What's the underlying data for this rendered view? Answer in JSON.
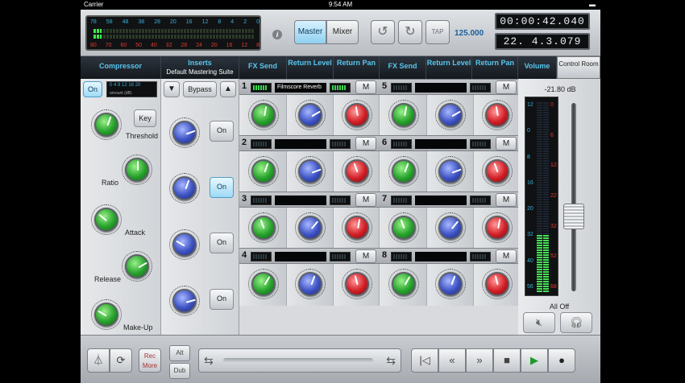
{
  "status": {
    "carrier": "Carrier",
    "time": "9:54 AM"
  },
  "meter": {
    "top_scale": [
      "78",
      "58",
      "48",
      "38",
      "28",
      "20",
      "16",
      "12",
      "8",
      "4",
      "2",
      "0"
    ],
    "bottom_scale": [
      "80",
      "70",
      "60",
      "50",
      "40",
      "32",
      "28",
      "24",
      "20",
      "16",
      "12",
      "8"
    ],
    "level_a": 0.05,
    "level_b": 0.05
  },
  "info_label": "i",
  "tabs": {
    "master": "Master",
    "mixer": "Mixer"
  },
  "tap_label": "TAP",
  "bpm": "125.000",
  "timecode": "00:00:42.040",
  "bars_beats": "22. 4.3.079",
  "compressor": {
    "title": "Compressor",
    "on_label": "On",
    "amount_scale": "0 4 8 12 16 20",
    "amount_label": "amount (dB)",
    "key_label": "Key",
    "params": [
      "Threshold",
      "Ratio",
      "Attack",
      "Release",
      "Make-Up"
    ]
  },
  "inserts": {
    "title": "Inserts",
    "preset": "Default Mastering Suite",
    "bypass_label": "Bypass",
    "on_label": "On"
  },
  "fx_headers": {
    "send": "FX Send",
    "return_level": "Return Level",
    "return_pan": "Return Pan"
  },
  "fx_slots": [
    {
      "num": "1",
      "plugin": "Filmscore Reverb",
      "m": "M"
    },
    {
      "num": "2",
      "plugin": "",
      "m": "M"
    },
    {
      "num": "3",
      "plugin": "",
      "m": "M"
    },
    {
      "num": "4",
      "plugin": "",
      "m": "M"
    },
    {
      "num": "5",
      "plugin": "",
      "m": "M"
    },
    {
      "num": "6",
      "plugin": "",
      "m": "M"
    },
    {
      "num": "7",
      "plugin": "",
      "m": "M"
    },
    {
      "num": "8",
      "plugin": "",
      "m": "M"
    }
  ],
  "volume": {
    "title": "Volume",
    "control_room": "Control Room",
    "db": "-21.80 dB",
    "scale_left": [
      "12",
      "0",
      "8",
      "16",
      "20",
      "32",
      "40",
      "56"
    ],
    "scale_right": [
      "0",
      "6",
      "12",
      "22",
      "32",
      "52",
      "68"
    ],
    "all_off": "All Off",
    "fader_level": 0.38
  },
  "bottom": {
    "rec_more": "Rec More",
    "alt": "Alt",
    "dub": "Dub"
  },
  "colors": {
    "accent": "#57c6ee",
    "header_bg": "#1b2128",
    "green_knob": "#27a32c",
    "blue_knob": "#3d52c4",
    "red_knob": "#d21e26"
  }
}
